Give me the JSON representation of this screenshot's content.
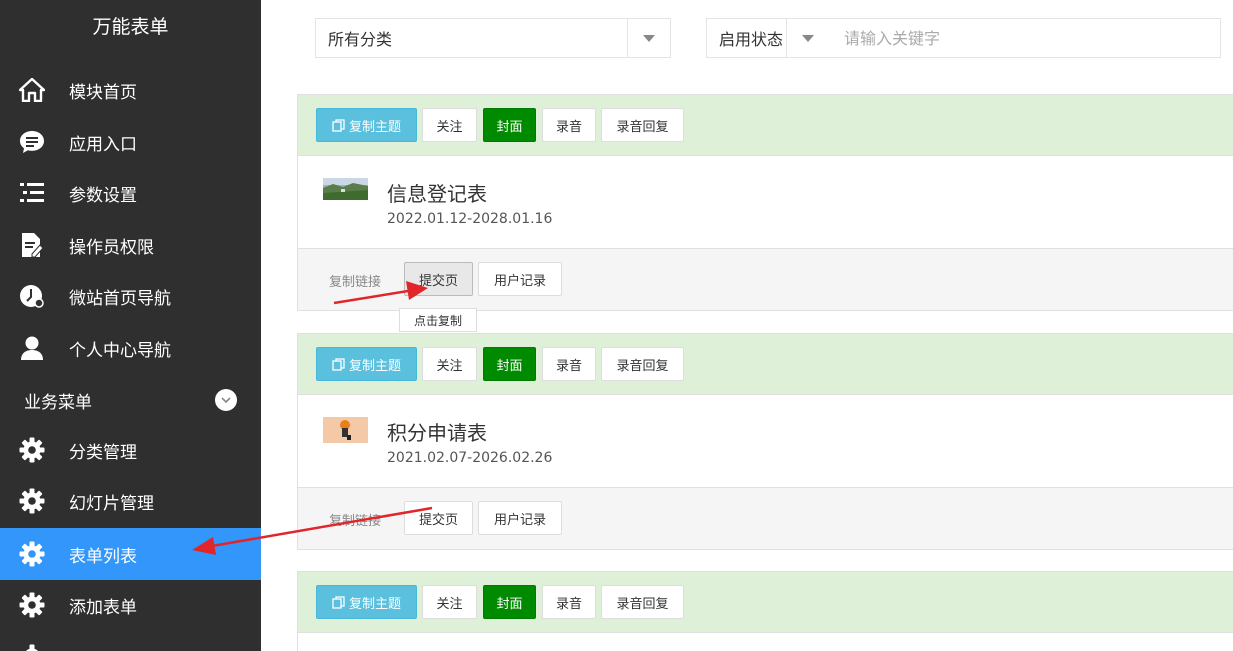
{
  "sidebar": {
    "app_title": "万能表单",
    "items": [
      {
        "label": "模块首页",
        "icon": "home-icon"
      },
      {
        "label": "应用入口",
        "icon": "chat-icon"
      },
      {
        "label": "参数设置",
        "icon": "list-icon"
      },
      {
        "label": "操作员权限",
        "icon": "document-edit-icon"
      },
      {
        "label": "微站首页导航",
        "icon": "clock-icon"
      },
      {
        "label": "个人中心导航",
        "icon": "user-icon"
      }
    ],
    "section_title": "业务菜单",
    "section_items": [
      {
        "label": "分类管理",
        "icon": "gear-icon"
      },
      {
        "label": "幻灯片管理",
        "icon": "gear-icon"
      },
      {
        "label": "表单列表",
        "icon": "gear-icon",
        "active": true
      },
      {
        "label": "添加表单",
        "icon": "gear-icon"
      }
    ],
    "active_color": "#3296fa"
  },
  "filters": {
    "category_value": "所有分类",
    "status_value": "启用状态",
    "search_placeholder": "请输入关键字"
  },
  "card_buttons": {
    "copy_theme": "复制主题",
    "follow": "关注",
    "cover": "封面",
    "record": "录音",
    "record_reply": "录音回复"
  },
  "footer_buttons": {
    "copy_link_label": "复制链接",
    "submit_page": "提交页",
    "user_records": "用户记录"
  },
  "tooltip": "点击复制",
  "forms": [
    {
      "title": "信息登记表",
      "date": "2022.01.12-2028.01.16"
    },
    {
      "title": "积分申请表",
      "date": "2021.02.07-2026.02.26"
    }
  ],
  "colors": {
    "card_header": "#dff0d8",
    "primary_button": "#5bc0de",
    "green_button": "#008a00",
    "arrow": "#e0262b"
  }
}
